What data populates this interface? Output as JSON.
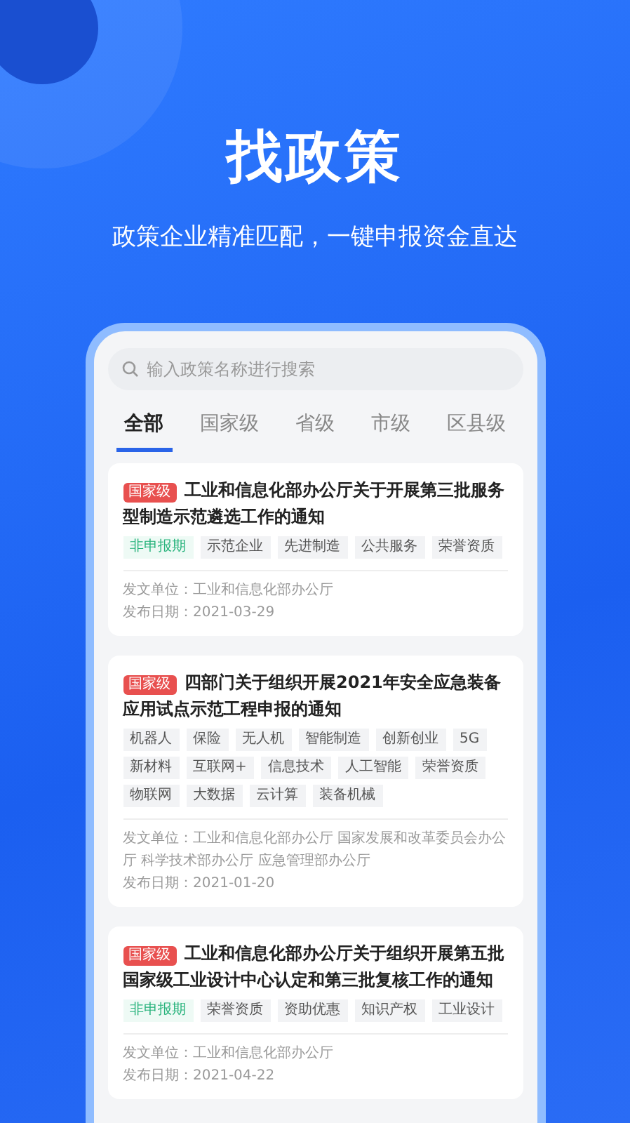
{
  "hero": {
    "title": "找政策",
    "subtitle": "政策企业精准匹配，一键申报资金直达"
  },
  "search": {
    "placeholder": "输入政策名称进行搜索"
  },
  "tabs": [
    {
      "label": "全部",
      "selected": true
    },
    {
      "label": "国家级",
      "selected": false
    },
    {
      "label": "省级",
      "selected": false
    },
    {
      "label": "市级",
      "selected": false
    },
    {
      "label": "区县级",
      "selected": false
    }
  ],
  "policies": [
    {
      "badge": "国家级",
      "title": "工业和信息化部办公厅关于开展第三批服务型制造示范遴选工作的通知",
      "tags": [
        {
          "label": "非申报期",
          "kind": "status"
        },
        {
          "label": "示范企业",
          "kind": "topic"
        },
        {
          "label": "先进制造",
          "kind": "topic"
        },
        {
          "label": "公共服务",
          "kind": "topic"
        },
        {
          "label": "荣誉资质",
          "kind": "topic"
        }
      ],
      "issuer": "发文单位：工业和信息化部办公厅",
      "date": "发布日期：2021-03-29"
    },
    {
      "badge": "国家级",
      "title": "四部门关于组织开展2021年安全应急装备应用试点示范工程申报的通知",
      "tags": [
        {
          "label": "机器人",
          "kind": "topic"
        },
        {
          "label": "保险",
          "kind": "topic"
        },
        {
          "label": "无人机",
          "kind": "topic"
        },
        {
          "label": "智能制造",
          "kind": "topic"
        },
        {
          "label": "创新创业",
          "kind": "topic"
        },
        {
          "label": "5G",
          "kind": "topic"
        },
        {
          "label": "新材料",
          "kind": "topic"
        },
        {
          "label": "互联网+",
          "kind": "topic"
        },
        {
          "label": "信息技术",
          "kind": "topic"
        },
        {
          "label": "人工智能",
          "kind": "topic"
        },
        {
          "label": "荣誉资质",
          "kind": "topic"
        },
        {
          "label": "物联网",
          "kind": "topic"
        },
        {
          "label": "大数据",
          "kind": "topic"
        },
        {
          "label": "云计算",
          "kind": "topic"
        },
        {
          "label": "装备机械",
          "kind": "topic"
        }
      ],
      "issuer": "发文单位：工业和信息化部办公厅 国家发展和改革委员会办公厅 科学技术部办公厅 应急管理部办公厅",
      "date": "发布日期：2021-01-20"
    },
    {
      "badge": "国家级",
      "title": "工业和信息化部办公厅关于组织开展第五批国家级工业设计中心认定和第三批复核工作的通知",
      "tags": [
        {
          "label": "非申报期",
          "kind": "status"
        },
        {
          "label": "荣誉资质",
          "kind": "topic"
        },
        {
          "label": "资助优惠",
          "kind": "topic"
        },
        {
          "label": "知识产权",
          "kind": "topic"
        },
        {
          "label": "工业设计",
          "kind": "topic"
        }
      ],
      "issuer": "发文单位：工业和信息化部办公厅",
      "date": "发布日期：2021-04-22"
    }
  ]
}
